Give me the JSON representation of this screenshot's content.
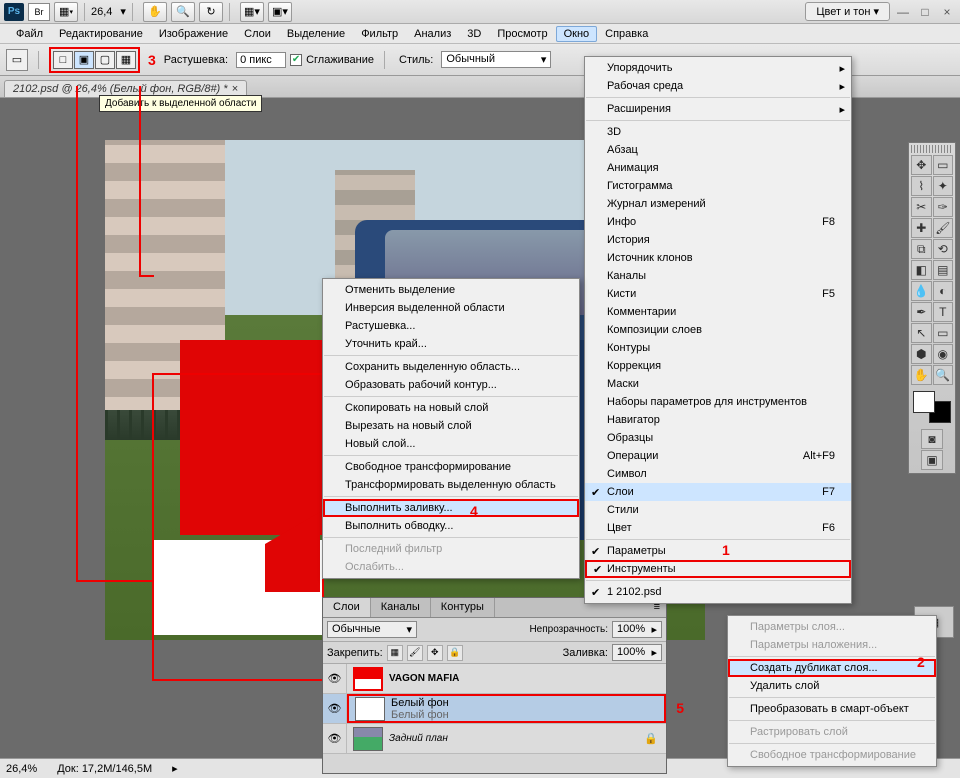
{
  "titlebar": {
    "ps": "Ps",
    "br": "Br",
    "zoom": "26,4",
    "right_dd": "Цвет и тон"
  },
  "menubar": {
    "items": [
      "Файл",
      "Редактирование",
      "Изображение",
      "Слои",
      "Выделение",
      "Фильтр",
      "Анализ",
      "3D",
      "Просмотр",
      "Окно",
      "Справка"
    ],
    "active_index": 9
  },
  "options": {
    "feather_label": "Растушевка:",
    "feather_value": "0 пикс",
    "antialias_label": "Сглаживание",
    "style_label": "Стиль:",
    "style_value": "Обычный"
  },
  "doc_tab": "2102.psd @ 26,4% (Белый фон, RGB/8#) *",
  "tooltip": "Добавить к выделенной области",
  "window_menu": {
    "items": [
      {
        "label": "Упорядочить",
        "arrow": true
      },
      {
        "label": "Рабочая среда",
        "arrow": true
      },
      {
        "sep": true
      },
      {
        "label": "Расширения",
        "arrow": true
      },
      {
        "sep": true
      },
      {
        "label": "3D"
      },
      {
        "label": "Абзац"
      },
      {
        "label": "Анимация"
      },
      {
        "label": "Гистограмма"
      },
      {
        "label": "Журнал измерений"
      },
      {
        "label": "Инфо",
        "shortcut": "F8"
      },
      {
        "label": "История"
      },
      {
        "label": "Источник клонов"
      },
      {
        "label": "Каналы"
      },
      {
        "label": "Кисти",
        "shortcut": "F5"
      },
      {
        "label": "Комментарии"
      },
      {
        "label": "Композиции слоев"
      },
      {
        "label": "Контуры"
      },
      {
        "label": "Коррекция"
      },
      {
        "label": "Маски"
      },
      {
        "label": "Наборы параметров для инструментов"
      },
      {
        "label": "Навигатор"
      },
      {
        "label": "Образцы"
      },
      {
        "label": "Операции",
        "shortcut": "Alt+F9"
      },
      {
        "label": "Символ"
      },
      {
        "label": "Слои",
        "shortcut": "F7",
        "check": true,
        "hl": true
      },
      {
        "label": "Стили"
      },
      {
        "label": "Цвет",
        "shortcut": "F6"
      },
      {
        "sep": true
      },
      {
        "label": "Параметры",
        "check": true
      },
      {
        "label": "Инструменты",
        "check": true,
        "red": true
      },
      {
        "sep": true
      },
      {
        "label": "1 2102.psd",
        "check": true
      }
    ]
  },
  "edit_menu": {
    "items": [
      {
        "label": "Отменить выделение"
      },
      {
        "label": "Инверсия выделенной области"
      },
      {
        "label": "Растушевка..."
      },
      {
        "label": "Уточнить край..."
      },
      {
        "sep": true
      },
      {
        "label": "Сохранить выделенную область..."
      },
      {
        "label": "Образовать рабочий контур..."
      },
      {
        "sep": true
      },
      {
        "label": "Скопировать на новый слой"
      },
      {
        "label": "Вырезать на новый слой"
      },
      {
        "label": "Новый слой..."
      },
      {
        "sep": true
      },
      {
        "label": "Свободное трансформирование"
      },
      {
        "label": "Трансформировать выделенную область"
      },
      {
        "sep": true
      },
      {
        "label": "Выполнить заливку...",
        "hl": true,
        "red": true
      },
      {
        "label": "Выполнить обводку..."
      },
      {
        "sep": true
      },
      {
        "label": "Последний фильтр",
        "disabled": true
      },
      {
        "label": "Ослабить...",
        "disabled": true
      }
    ]
  },
  "layer_ctx": {
    "items": [
      {
        "label": "Параметры слоя...",
        "disabled": true
      },
      {
        "label": "Параметры наложения...",
        "disabled": true
      },
      {
        "sep": true
      },
      {
        "label": "Создать дубликат слоя...",
        "hl": true,
        "red": true
      },
      {
        "label": "Удалить слой"
      },
      {
        "sep": true
      },
      {
        "label": "Преобразовать в смарт-объект"
      },
      {
        "sep": true
      },
      {
        "label": "Растрировать слой",
        "disabled": true
      },
      {
        "sep": true
      },
      {
        "label": "Свободное трансформирование",
        "disabled": true
      }
    ]
  },
  "layers_panel": {
    "tabs": [
      "Слои",
      "Каналы",
      "Контуры"
    ],
    "blend": "Обычные",
    "opacity_label": "Непрозрачность:",
    "opacity_value": "100%",
    "lock_label": "Закрепить:",
    "fill_label": "Заливка:",
    "fill_value": "100%",
    "layers": [
      {
        "name": "VAGON MAFIA",
        "bold": true
      },
      {
        "name": "Белый фон",
        "sub": "Белый фон",
        "selected": true,
        "red": true
      },
      {
        "name": "Задний план",
        "italic": true,
        "lock": true
      }
    ]
  },
  "status": {
    "zoom": "26,4%",
    "doc": "Док: 17,2M/146,5M"
  },
  "annotations": {
    "n1": "1",
    "n2": "2",
    "n3": "3",
    "n4": "4",
    "n5": "5"
  }
}
